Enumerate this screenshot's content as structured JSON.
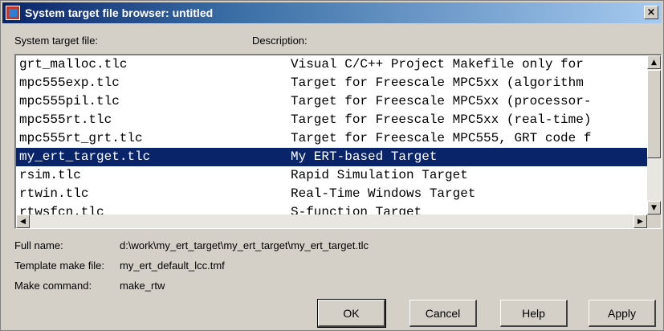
{
  "window": {
    "title": "System target file browser: untitled"
  },
  "headers": {
    "col1": "System target file:",
    "col2": "Description:"
  },
  "rows": [
    {
      "file": "grt_malloc.tlc",
      "desc": "Visual C/C++ Project Makefile only for"
    },
    {
      "file": "mpc555exp.tlc",
      "desc": "Target for Freescale MPC5xx (algorithm"
    },
    {
      "file": "mpc555pil.tlc",
      "desc": "Target for Freescale MPC5xx (processor-"
    },
    {
      "file": "mpc555rt.tlc",
      "desc": "Target for Freescale MPC5xx (real-time)"
    },
    {
      "file": "mpc555rt_grt.tlc",
      "desc": "Target for Freescale MPC555, GRT code f"
    },
    {
      "file": "my_ert_target.tlc",
      "desc": "My ERT-based Target"
    },
    {
      "file": "rsim.tlc",
      "desc": "Rapid Simulation Target"
    },
    {
      "file": "rtwin.tlc",
      "desc": "Real-Time Windows Target"
    },
    {
      "file": "rtwsfcn.tlc",
      "desc": "S-function Target"
    }
  ],
  "selected_row": "my_ert_target.tlc",
  "details": {
    "full_name_label": "Full name:",
    "full_name_value": "d:\\work\\my_ert_target\\my_ert_target\\my_ert_target.tlc",
    "template_label": "Template make file:",
    "template_value": "my_ert_default_lcc.tmf",
    "make_label": "Make command:",
    "make_value": "make_rtw"
  },
  "buttons": {
    "ok": "OK",
    "cancel": "Cancel",
    "help": "Help",
    "apply": "Apply"
  },
  "icons": {
    "close": "×",
    "scroll_up": "▲",
    "scroll_down": "▼",
    "scroll_left": "◀",
    "scroll_right": "▶"
  }
}
